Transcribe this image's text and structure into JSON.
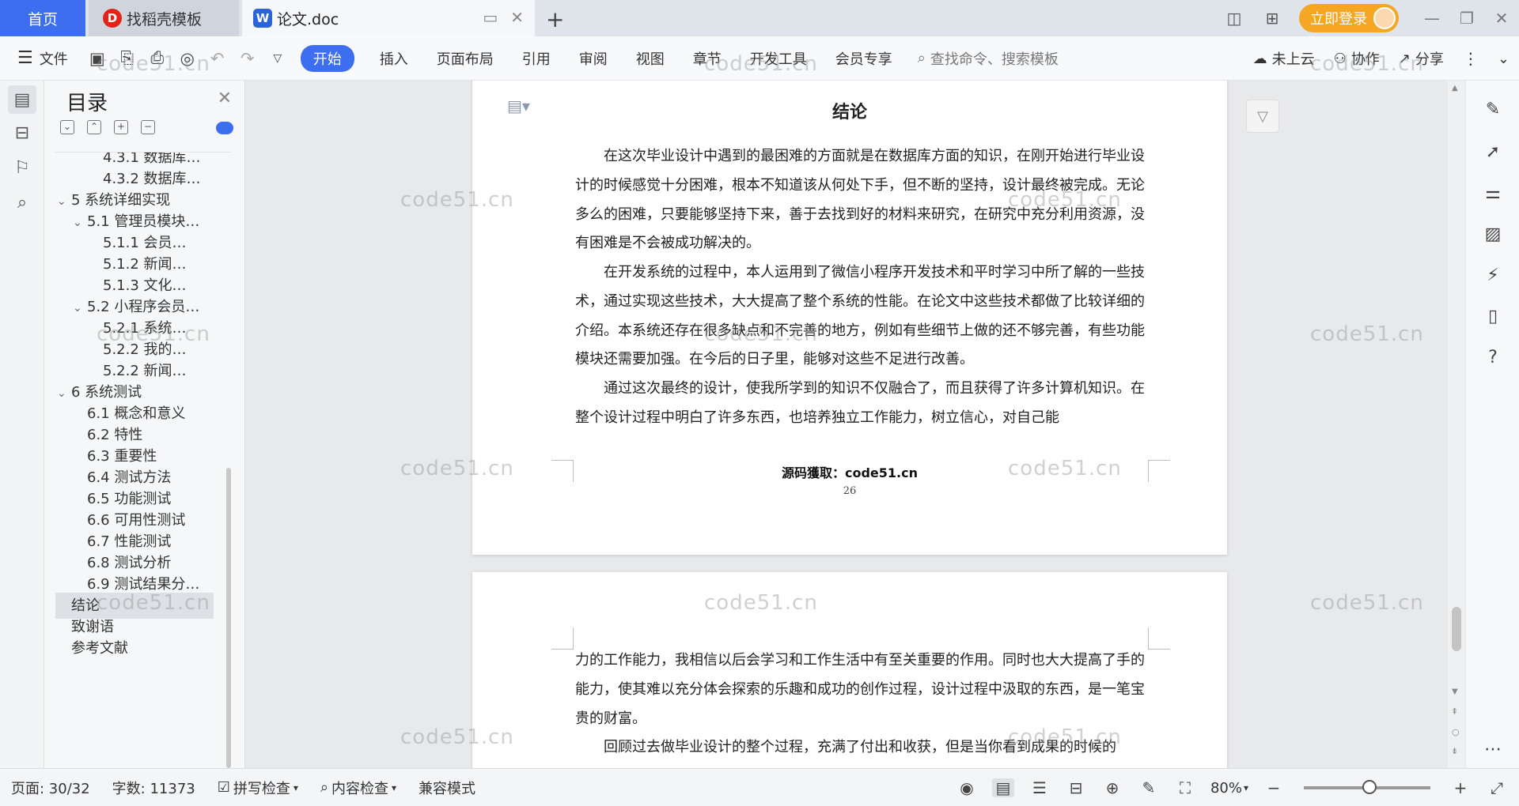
{
  "tabs": {
    "home": "首页",
    "template": "找稻壳模板",
    "document": "论文.doc"
  },
  "titlebar": {
    "login_label": "立即登录"
  },
  "ribbon": {
    "file_label": "文件",
    "tabs": [
      "开始",
      "插入",
      "页面布局",
      "引用",
      "审阅",
      "视图",
      "章节",
      "开发工具",
      "会员专享"
    ],
    "search_placeholder": "查找命令、搜索模板",
    "cloud_label": "未上云",
    "collab_label": "协作",
    "share_label": "分享"
  },
  "toc": {
    "title": "目录",
    "items": [
      {
        "label": "4.3.1 数据库…",
        "level": 3
      },
      {
        "label": "4.3.2 数据库…",
        "level": 3
      },
      {
        "label": "5 系统详细实现",
        "level": 1
      },
      {
        "label": "5.1 管理员模块…",
        "level": 2
      },
      {
        "label": "5.1.1 会员…",
        "level": 3
      },
      {
        "label": "5.1.2 新闻…",
        "level": 3
      },
      {
        "label": "5.1.3 文化…",
        "level": 3
      },
      {
        "label": "5.2 小程序会员…",
        "level": 2
      },
      {
        "label": "5.2.1 系统…",
        "level": 3
      },
      {
        "label": "5.2.2 我的…",
        "level": 3
      },
      {
        "label": "5.2.2 新闻…",
        "level": 3
      },
      {
        "label": "6 系统测试",
        "level": 1
      },
      {
        "label": "6.1 概念和意义",
        "level": 2
      },
      {
        "label": "6.2 特性",
        "level": 2
      },
      {
        "label": "6.3 重要性",
        "level": 2
      },
      {
        "label": "6.4 测试方法",
        "level": 2
      },
      {
        "label": "6.5 功能测试",
        "level": 2
      },
      {
        "label": "6.6 可用性测试",
        "level": 2
      },
      {
        "label": "6.7 性能测试",
        "level": 2
      },
      {
        "label": "6.8 测试分析",
        "level": 2
      },
      {
        "label": "6.9 测试结果分…",
        "level": 2
      },
      {
        "label": "结论",
        "level": 1,
        "active": true
      },
      {
        "label": "致谢语",
        "level": 1
      },
      {
        "label": "参考文献",
        "level": 1
      }
    ]
  },
  "document": {
    "title": "结论",
    "page_number": "26",
    "paragraphs_page1": [
      "在这次毕业设计中遇到的最困难的方面就是在数据库方面的知识，在刚开始进行毕业设计的时候感觉十分困难，根本不知道该从何处下手，但不断的坚持，设计最终被完成。无论多么的困难，只要能够坚持下来，善于去找到好的材料来研究，在研究中充分利用资源，没有困难是不会被成功解决的。",
      "在开发系统的过程中，本人运用到了微信小程序开发技术和平时学习中所了解的一些技术，通过实现这些技术，大大提高了整个系统的性能。在论文中这些技术都做了比较详细的介绍。本系统还存在很多缺点和不完善的地方，例如有些细节上做的还不够完善，有些功能模块还需要加强。在今后的日子里，能够对这些不足进行改善。",
      "通过这次最终的设计，使我所学到的知识不仅融合了，而且获得了许多计算机知识。在整个设计过程中明白了许多东西，也培养独立工作能力，树立信心，对自己能"
    ],
    "overlay_text": "源码獲取：code51.cn",
    "paragraphs_page2": [
      "力的工作能力，我相信以后会学习和工作生活中有至关重要的作用。同时也大大提高了手的能力，使其难以充分体会探索的乐趣和成功的创作过程，设计过程中汲取的东西，是一笔宝贵的财富。",
      "回顾过去做毕业设计的整个过程，充满了付出和收获，但是当你看到成果的时候的"
    ]
  },
  "watermark_text": "code51.cn",
  "statusbar": {
    "page": "页面: 30/32",
    "words": "字数: 11373",
    "spell_check": "拼写检查",
    "content_check": "内容检查",
    "compat_mode": "兼容模式",
    "zoom": "80%"
  },
  "colors": {
    "accent": "#3e6ef0",
    "login": "#f5a623"
  }
}
